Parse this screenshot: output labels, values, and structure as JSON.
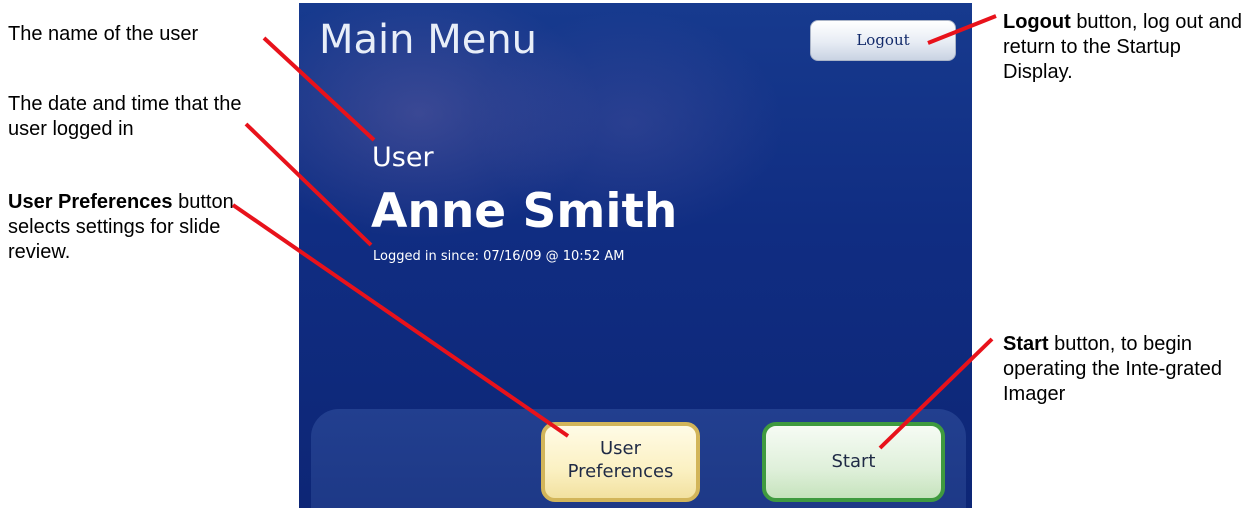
{
  "annotations": {
    "name": "The name of the user",
    "date": "The date and time that the user logged in",
    "prefs_bold": "User Preferences",
    "prefs_rest": "button selects settings for slide review.",
    "logout_bold": "Logout",
    "logout_rest": "button, log out and return to the Startup Display.",
    "start_bold": "Start",
    "start_rest": "button, to begin operating the Inte-grated Imager"
  },
  "screen": {
    "title": "Main Menu",
    "logout_label": "Logout",
    "user_label": "User",
    "user_name": "Anne Smith",
    "logged_in": "Logged in since: 07/16/09 @ 10:52 AM",
    "prefs_label": "User Preferences",
    "start_label": "Start"
  },
  "colors": {
    "screen_bg": "#102d82",
    "annotation_line": "#e8121b",
    "prefs_border": "#d2b55a",
    "start_border": "#3f9a3f"
  }
}
